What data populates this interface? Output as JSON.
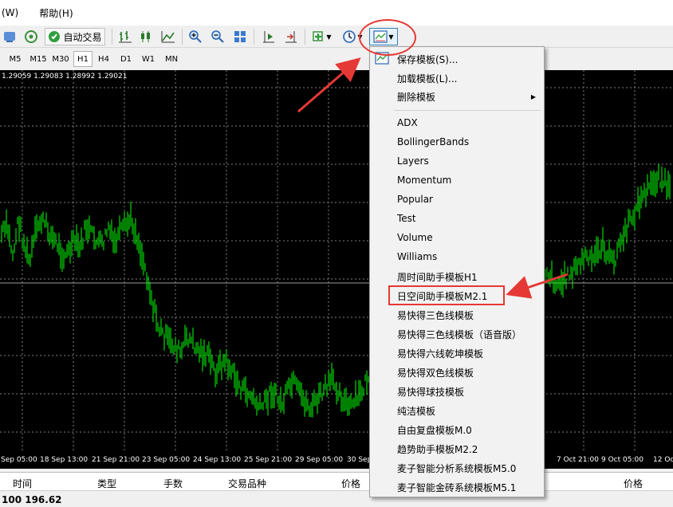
{
  "menubar": {
    "items": [
      "(W)",
      "帮助(H)"
    ]
  },
  "toolbar": {
    "auto_trade_label": "自动交易"
  },
  "timeframes": [
    "M5",
    "M15",
    "M30",
    "H1",
    "H4",
    "D1",
    "W1",
    "MN"
  ],
  "active_timeframe": "H1",
  "chart": {
    "ohlc_text": "1.29059 1.29083 1.28992 1.29021",
    "candle_color": "#00ff00",
    "background": "#000000",
    "grid_color": "#7f7f7f",
    "x_labels": [
      "Sep 05:00",
      "18 Sep 13:00",
      "21 Sep 21:00",
      "23 Sep 05:00",
      "24 Sep 13:00",
      "25 Sep 21:00",
      "29 Sep 05:00",
      "30 Sep 13:00",
      "7 Oct 21:00",
      "9 Oct 05:00",
      "12 Oc"
    ],
    "series_norm": [
      0.58,
      0.6,
      0.52,
      0.62,
      0.55,
      0.5,
      0.58,
      0.62,
      0.6,
      0.57,
      0.55,
      0.52,
      0.53,
      0.56,
      0.54,
      0.6,
      0.58,
      0.56,
      0.55,
      0.6,
      0.55,
      0.58,
      0.6,
      0.62,
      0.58,
      0.52,
      0.46,
      0.38,
      0.32,
      0.3,
      0.28,
      0.27,
      0.25,
      0.3,
      0.28,
      0.26,
      0.25,
      0.24,
      0.2,
      0.22,
      0.23,
      0.2,
      0.17,
      0.15,
      0.14,
      0.12,
      0.1,
      0.12,
      0.15,
      0.13,
      0.11,
      0.15,
      0.17,
      0.14,
      0.12,
      0.1,
      0.12,
      0.14,
      0.16,
      0.18,
      0.15,
      0.12,
      0.1,
      0.12,
      0.14,
      0.18,
      0.2,
      0.17,
      0.14,
      0.12,
      0.1,
      0.12,
      0.15,
      0.18,
      0.2,
      0.24,
      0.28,
      0.4,
      0.43,
      0.38,
      0.35,
      0.33,
      0.36,
      0.4,
      0.38,
      0.35,
      0.33,
      0.35,
      0.38,
      0.4,
      0.37,
      0.35,
      0.32,
      0.3,
      0.34,
      0.4,
      0.45,
      0.48,
      0.46,
      0.44,
      0.45,
      0.47,
      0.48,
      0.5,
      0.52,
      0.5,
      0.53,
      0.55,
      0.52,
      0.5,
      0.55,
      0.58,
      0.62,
      0.65,
      0.68,
      0.7,
      0.72,
      0.74,
      0.72,
      0.7
    ]
  },
  "terminal": {
    "headers": [
      "时间",
      "类型",
      "手数",
      "交易品种",
      "价格",
      "价格"
    ]
  },
  "status": {
    "balance": "100 196.62"
  },
  "context_menu": {
    "save_template": "保存模板(S)...",
    "load_template": "加载模板(L)...",
    "delete_template": "删除模板",
    "templates": [
      "ADX",
      "BollingerBands",
      "Layers",
      "Momentum",
      "Popular",
      "Test",
      "Volume",
      "Williams",
      "周时间助手模板H1",
      "日空间助手模板M2.1",
      "易快得三色线模板",
      "易快得三色线模板（语音版）",
      "易快得六线乾坤模板",
      "易快得双色线模板",
      "易快得球技模板",
      "纯洁模板",
      "自由复盘模板M.0",
      "趋势助手模板M2.2",
      "麦子智能分析系统模板M5.0",
      "麦子智能金砖系统模板M5.1"
    ],
    "highlighted": "日空间助手模板M2.1"
  },
  "colors": {
    "annotation": "#e53935",
    "menu_bg": "#f2f2f2"
  }
}
